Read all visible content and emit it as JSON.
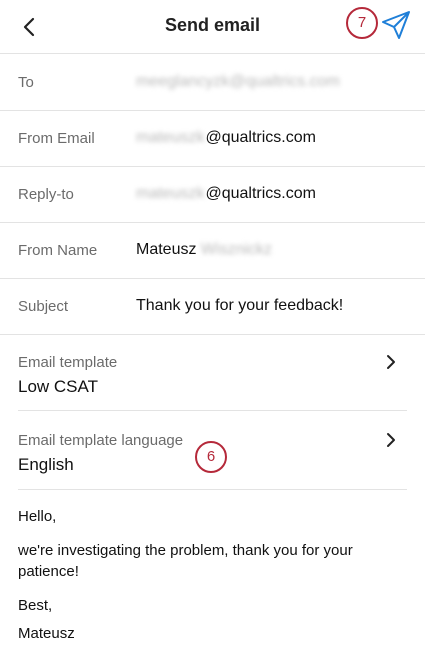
{
  "header": {
    "title": "Send email",
    "send_callout": "7"
  },
  "fields": {
    "to": {
      "label": "To",
      "value": "meeglancyzk@qualtrics.com"
    },
    "from_email": {
      "label": "From Email",
      "value_blurred": "mateuszk",
      "value_domain": "@qualtrics.com"
    },
    "reply_to": {
      "label": "Reply-to",
      "value_blurred": "mateuszk",
      "value_domain": "@qualtrics.com"
    },
    "from_name": {
      "label": "From Name",
      "first_name": "Mateusz",
      "last_name_blurred": "Wisznickz"
    },
    "subject": {
      "label": "Subject",
      "value": "Thank you for your feedback!"
    }
  },
  "template": {
    "label": "Email template",
    "value": "Low CSAT"
  },
  "template_language": {
    "label": "Email template language",
    "value": "English",
    "callout": "6"
  },
  "message": {
    "greeting": "Hello,",
    "body": "we're investigating the problem, thank you for your patience!",
    "closing": "Best,",
    "signature": "Mateusz"
  },
  "colors": {
    "accent": "#1f7fd8",
    "callout": "#b5293a",
    "divider": "#e3e3e3",
    "label": "#6b6b6b"
  }
}
